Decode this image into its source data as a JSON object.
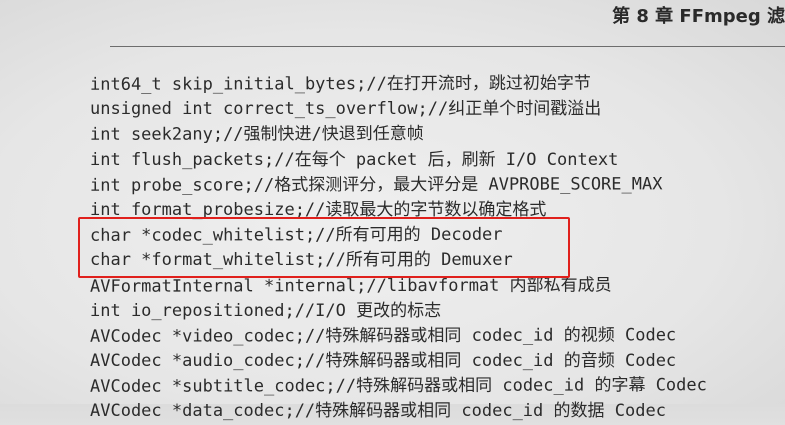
{
  "running_head": "第 8 章   FFmpeg 滤",
  "code_lines": [
    "int64_t skip_initial_bytes;//在打开流时，跳过初始字节",
    "unsigned int correct_ts_overflow;//纠正单个时间戳溢出",
    "int seek2any;//强制快进/快退到任意帧",
    "int flush_packets;//在每个 packet 后，刷新 I/O Context",
    "int probe_score;//格式探测评分，最大评分是 AVPROBE_SCORE_MAX",
    "int format_probesize;//读取最大的字节数以确定格式",
    "char *codec_whitelist;//所有可用的 Decoder",
    "char *format_whitelist;//所有可用的 Demuxer",
    "AVFormatInternal *internal;//libavformat 内部私有成员",
    "int io_repositioned;//I/O 更改的标志",
    "AVCodec *video_codec;//特殊解码器或相同 codec_id 的视频 Codec",
    "AVCodec *audio_codec;//特殊解码器或相同 codec_id 的音频 Codec",
    "AVCodec *subtitle_codec;//特殊解码器或相同 codec_id 的字幕 Codec",
    "AVCodec *data_codec;//特殊解码器或相同 codec_id 的数据 Codec"
  ],
  "highlight_color": "#e0201c"
}
